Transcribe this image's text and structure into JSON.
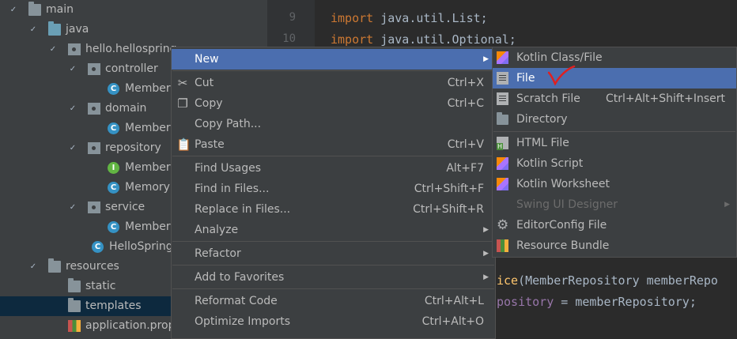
{
  "tree": [
    {
      "label": "main",
      "depth": 0,
      "arrow": "✓",
      "icon": "folder"
    },
    {
      "label": "java",
      "depth": 1,
      "arrow": "✓",
      "icon": "folder-blue"
    },
    {
      "label": "hello.hellospring",
      "depth": 2,
      "arrow": "✓",
      "icon": "package"
    },
    {
      "label": "controller",
      "depth": 3,
      "arrow": "✓",
      "icon": "package"
    },
    {
      "label": "MemberC",
      "depth": 4,
      "arrow": "",
      "icon": "class"
    },
    {
      "label": "domain",
      "depth": 3,
      "arrow": "✓",
      "icon": "package"
    },
    {
      "label": "Member",
      "depth": 4,
      "arrow": "",
      "icon": "class"
    },
    {
      "label": "repository",
      "depth": 3,
      "arrow": "✓",
      "icon": "package"
    },
    {
      "label": "MemberR",
      "depth": 4,
      "arrow": "",
      "icon": "interface"
    },
    {
      "label": "MemoryM",
      "depth": 4,
      "arrow": "",
      "icon": "class"
    },
    {
      "label": "service",
      "depth": 3,
      "arrow": "✓",
      "icon": "package"
    },
    {
      "label": "MemberS",
      "depth": 4,
      "arrow": "",
      "icon": "class"
    },
    {
      "label": "HelloSpringA",
      "depth": 3.2,
      "arrow": "",
      "icon": "class"
    },
    {
      "label": "resources",
      "depth": 1,
      "arrow": "✓",
      "icon": "folder"
    },
    {
      "label": "static",
      "depth": 2,
      "arrow": "",
      "icon": "folder"
    },
    {
      "label": "templates",
      "depth": 2,
      "arrow": "",
      "icon": "folder",
      "selected": true
    },
    {
      "label": "application.prop",
      "depth": 2,
      "arrow": "",
      "icon": "properties"
    }
  ],
  "editor": {
    "line_numbers": [
      "9",
      "10"
    ],
    "lines": [
      {
        "kw": "import",
        "rest": " java.util.List;"
      },
      {
        "kw": "import",
        "rest": " java.util.Optional;"
      }
    ],
    "bottom_lines": [
      {
        "fn": "ice",
        "rest": "(MemberRepository memberRepo"
      },
      {
        "fld": "pository",
        "rest": " = memberRepository;"
      }
    ]
  },
  "context_menu": [
    {
      "label": "New",
      "shortcut": "",
      "submenu": true,
      "icon": "",
      "highlighted": true
    },
    {
      "sep": true
    },
    {
      "label": "Cut",
      "shortcut": "Ctrl+X",
      "icon": "scissors-icon",
      "glyph": "✂"
    },
    {
      "label": "Copy",
      "shortcut": "Ctrl+C",
      "icon": "copy-icon",
      "glyph": "❐"
    },
    {
      "label": "Copy Path...",
      "shortcut": "",
      "icon": ""
    },
    {
      "label": "Paste",
      "shortcut": "Ctrl+V",
      "icon": "paste-icon",
      "glyph": "📋"
    },
    {
      "sep": true
    },
    {
      "label": "Find Usages",
      "shortcut": "Alt+F7",
      "icon": ""
    },
    {
      "label": "Find in Files...",
      "shortcut": "Ctrl+Shift+F",
      "icon": ""
    },
    {
      "label": "Replace in Files...",
      "shortcut": "Ctrl+Shift+R",
      "icon": ""
    },
    {
      "label": "Analyze",
      "shortcut": "",
      "submenu": true,
      "icon": ""
    },
    {
      "sep": true
    },
    {
      "label": "Refactor",
      "shortcut": "",
      "submenu": true,
      "icon": ""
    },
    {
      "sep": true
    },
    {
      "label": "Add to Favorites",
      "shortcut": "",
      "submenu": true,
      "icon": ""
    },
    {
      "sep": true
    },
    {
      "label": "Reformat Code",
      "shortcut": "Ctrl+Alt+L",
      "icon": ""
    },
    {
      "label": "Optimize Imports",
      "shortcut": "Ctrl+Alt+O",
      "icon": ""
    }
  ],
  "submenu": [
    {
      "label": "Kotlin Class/File",
      "shortcut": "",
      "icon": "kotlin-icon"
    },
    {
      "label": "File",
      "shortcut": "",
      "icon": "file-icon",
      "highlighted": true
    },
    {
      "label": "Scratch File",
      "shortcut": "Ctrl+Alt+Shift+Insert",
      "icon": "scratch-file-icon"
    },
    {
      "label": "Directory",
      "shortcut": "",
      "icon": "directory-icon"
    },
    {
      "sep": true
    },
    {
      "label": "HTML File",
      "shortcut": "",
      "icon": "html-file-icon"
    },
    {
      "label": "Kotlin Script",
      "shortcut": "",
      "icon": "kotlin-script-icon"
    },
    {
      "label": "Kotlin Worksheet",
      "shortcut": "",
      "icon": "kotlin-worksheet-icon"
    },
    {
      "label": "Swing UI Designer",
      "shortcut": "",
      "icon": "",
      "disabled": true,
      "submenu": true
    },
    {
      "label": "EditorConfig File",
      "shortcut": "",
      "icon": "gear-icon"
    },
    {
      "label": "Resource Bundle",
      "shortcut": "",
      "icon": "resource-bundle-icon"
    }
  ],
  "annotation_color": "#e02020"
}
